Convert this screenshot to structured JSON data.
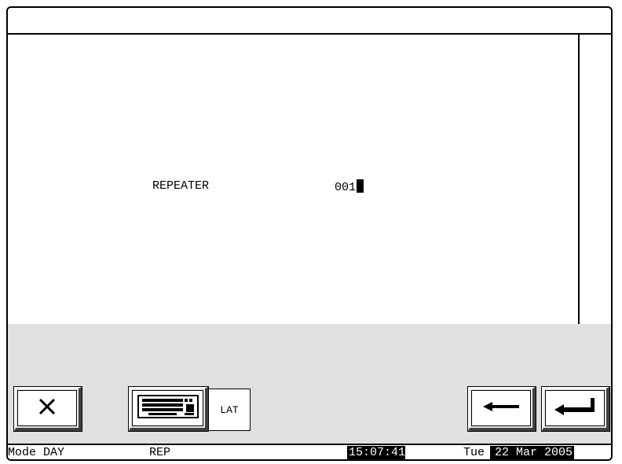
{
  "title": "",
  "form": {
    "label": "REPEATER",
    "value": "001"
  },
  "buttons": {
    "close_icon": "close-icon",
    "keyboard_icon": "keyboard-icon",
    "lat_label": "LAT",
    "backspace_icon": "arrow-left-icon",
    "enter_icon": "enter-icon"
  },
  "status": {
    "mode": "Mode DAY",
    "screen": "REP",
    "time": "15:07:41",
    "weekday": "Tue",
    "date": "22 Mar 2005"
  },
  "colors": {
    "panel": "#e0e0e0",
    "inverse_bg": "#000000",
    "inverse_fg": "#ffffff"
  }
}
